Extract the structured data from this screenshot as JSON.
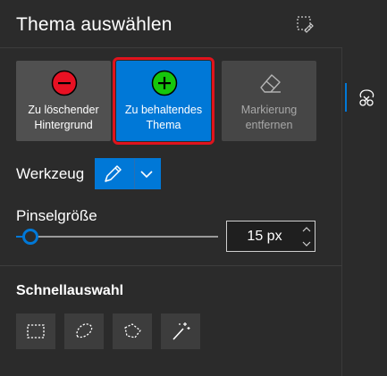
{
  "header": {
    "title": "Thema auswählen",
    "action_icon": "crop-edit-icon"
  },
  "modes": [
    {
      "label": "Zu löschender\nHintergrund",
      "icon": "minus-circle-icon",
      "color": "#e81123",
      "selected": false
    },
    {
      "label": "Zu behaltendes\nThema",
      "icon": "plus-circle-icon",
      "color": "#16c60c",
      "selected": true
    },
    {
      "label": "Markierung\nentfernen",
      "icon": "eraser-icon",
      "selected": false,
      "disabled": true
    }
  ],
  "tool": {
    "label": "Werkzeug",
    "current_icon": "pen-icon",
    "dropdown_icon": "chevron-down-icon"
  },
  "brush": {
    "label": "Pinselgröße",
    "value_text": "15 px",
    "slider_fraction": 0.07
  },
  "quick": {
    "label": "Schnellauswahl",
    "tools": [
      "rectangle-select-icon",
      "lasso-icon",
      "polygon-lasso-icon",
      "magic-wand-icon"
    ]
  },
  "rightbar": {
    "active_icon": "cutout-scissors-icon"
  },
  "colors": {
    "accent": "#0078d7",
    "highlight_outline": "#e0131d",
    "panel_bg": "#2b2b2b"
  }
}
